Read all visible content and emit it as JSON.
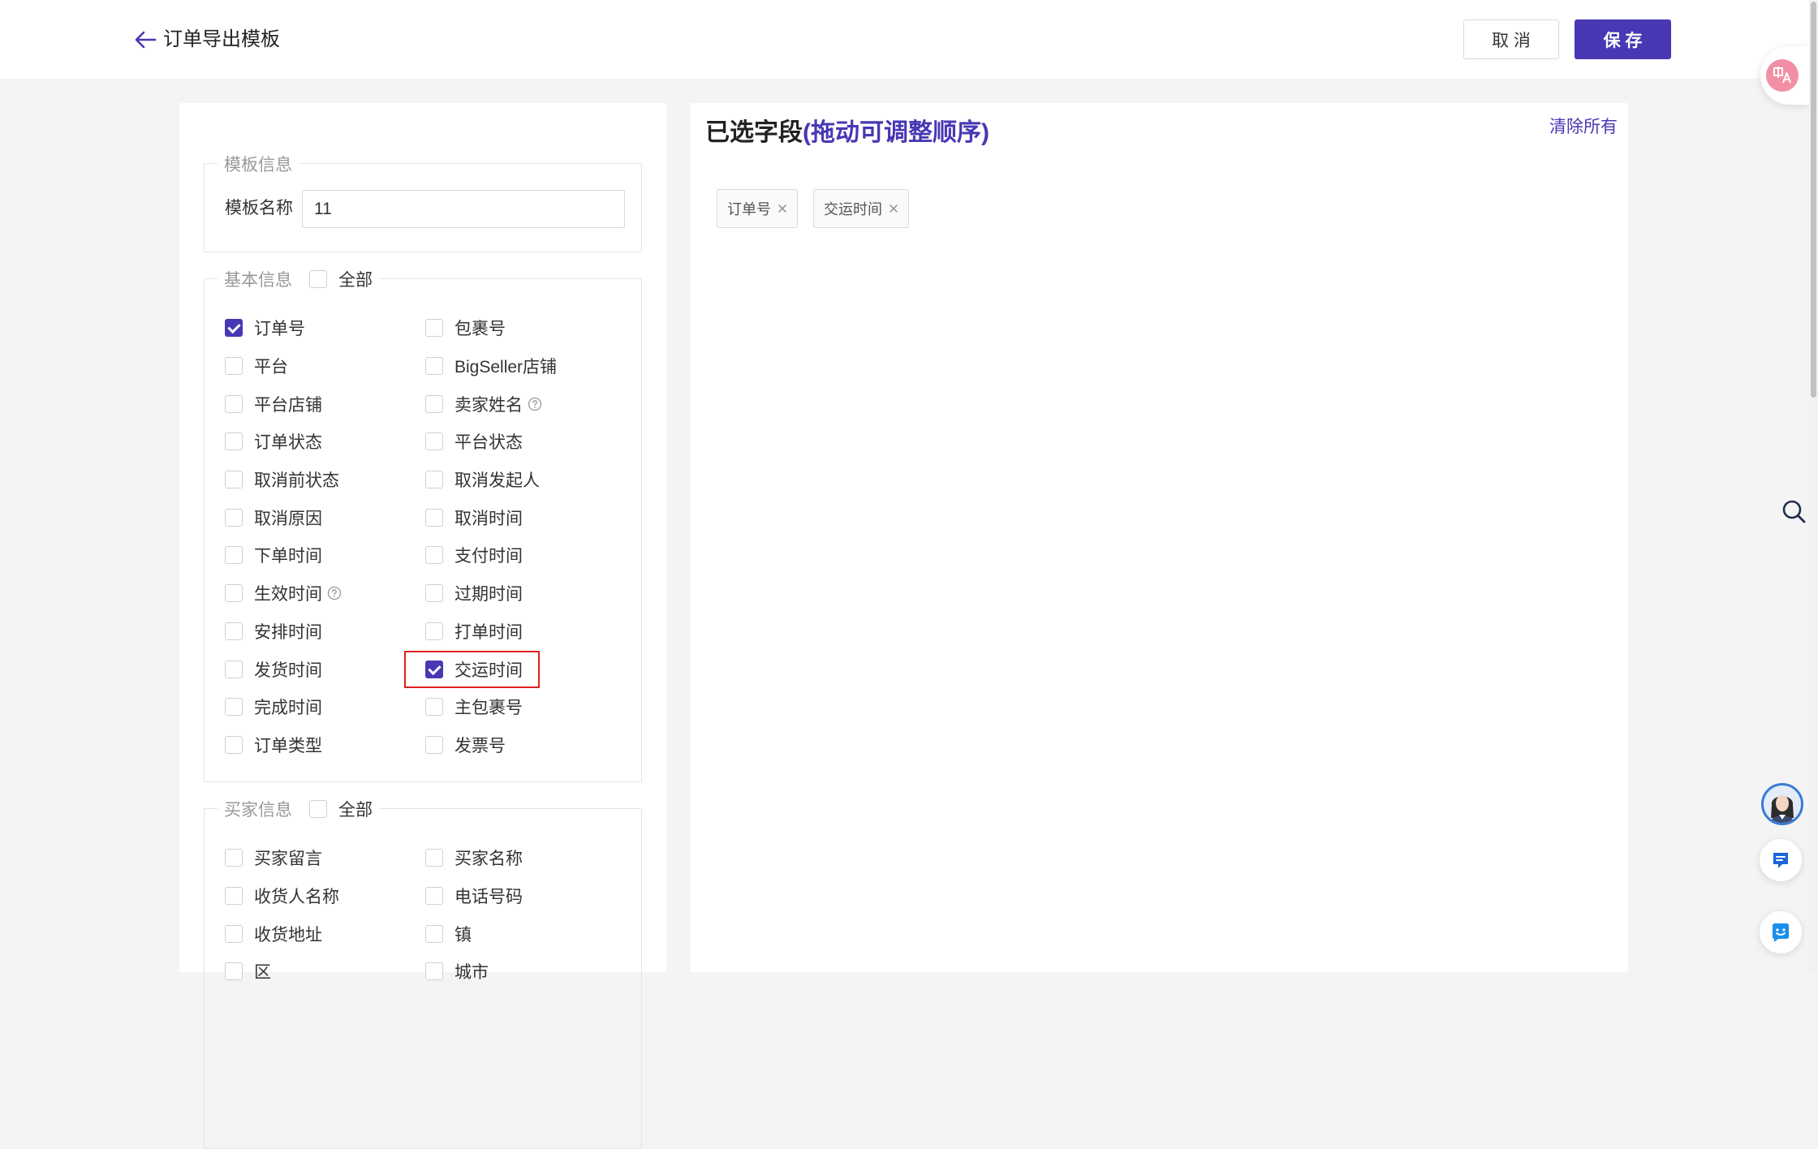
{
  "header": {
    "back_icon": "arrow-left-icon",
    "title": "订单导出模板",
    "cancel_label": "取 消",
    "save_label": "保 存"
  },
  "template_info": {
    "legend": "模板信息",
    "name_label": "模板名称",
    "name_value": "11"
  },
  "basic_info": {
    "legend": "基本信息",
    "all_label": "全部",
    "all_checked": false,
    "rows": [
      [
        {
          "label": "订单号",
          "checked": true
        },
        {
          "label": "包裹号",
          "checked": false
        }
      ],
      [
        {
          "label": "平台",
          "checked": false
        },
        {
          "label": "BigSeller店铺",
          "checked": false
        }
      ],
      [
        {
          "label": "平台店铺",
          "checked": false
        },
        {
          "label": "卖家姓名",
          "checked": false,
          "help": true
        }
      ],
      [
        {
          "label": "订单状态",
          "checked": false
        },
        {
          "label": "平台状态",
          "checked": false
        }
      ],
      [
        {
          "label": "取消前状态",
          "checked": false
        },
        {
          "label": "取消发起人",
          "checked": false
        }
      ],
      [
        {
          "label": "取消原因",
          "checked": false
        },
        {
          "label": "取消时间",
          "checked": false
        }
      ],
      [
        {
          "label": "下单时间",
          "checked": false
        },
        {
          "label": "支付时间",
          "checked": false
        }
      ],
      [
        {
          "label": "生效时间",
          "checked": false,
          "help": true
        },
        {
          "label": "过期时间",
          "checked": false
        }
      ],
      [
        {
          "label": "安排时间",
          "checked": false
        },
        {
          "label": "打单时间",
          "checked": false
        }
      ],
      [
        {
          "label": "发货时间",
          "checked": false
        },
        {
          "label": "交运时间",
          "checked": true,
          "highlight": true
        }
      ],
      [
        {
          "label": "完成时间",
          "checked": false
        },
        {
          "label": "主包裹号",
          "checked": false
        }
      ],
      [
        {
          "label": "订单类型",
          "checked": false
        },
        {
          "label": "发票号",
          "checked": false
        }
      ]
    ]
  },
  "buyer_info": {
    "legend": "买家信息",
    "all_label": "全部",
    "all_checked": false,
    "rows": [
      [
        {
          "label": "买家留言",
          "checked": false
        },
        {
          "label": "买家名称",
          "checked": false
        }
      ],
      [
        {
          "label": "收货人名称",
          "checked": false
        },
        {
          "label": "电话号码",
          "checked": false
        }
      ],
      [
        {
          "label": "收货地址",
          "checked": false
        },
        {
          "label": "镇",
          "checked": false
        }
      ],
      [
        {
          "label": "区",
          "checked": false
        },
        {
          "label": "城市",
          "checked": false
        }
      ]
    ]
  },
  "selected_fields": {
    "title": "已选字段",
    "hint": "(拖动可调整顺序)",
    "clear_label": "清除所有",
    "tags": [
      "订单号",
      "交运时间"
    ],
    "tag_close_icon": "close-icon"
  },
  "floating_tools": {
    "translate_icon": "translate-icon",
    "search_icon": "search-icon",
    "avatar": "support-avatar",
    "chat_icon": "message-icon",
    "feedback_icon": "smile-icon"
  },
  "colors": {
    "primary": "#4838b3",
    "highlight": "#e02020",
    "page_bg": "#f4f4f4"
  }
}
